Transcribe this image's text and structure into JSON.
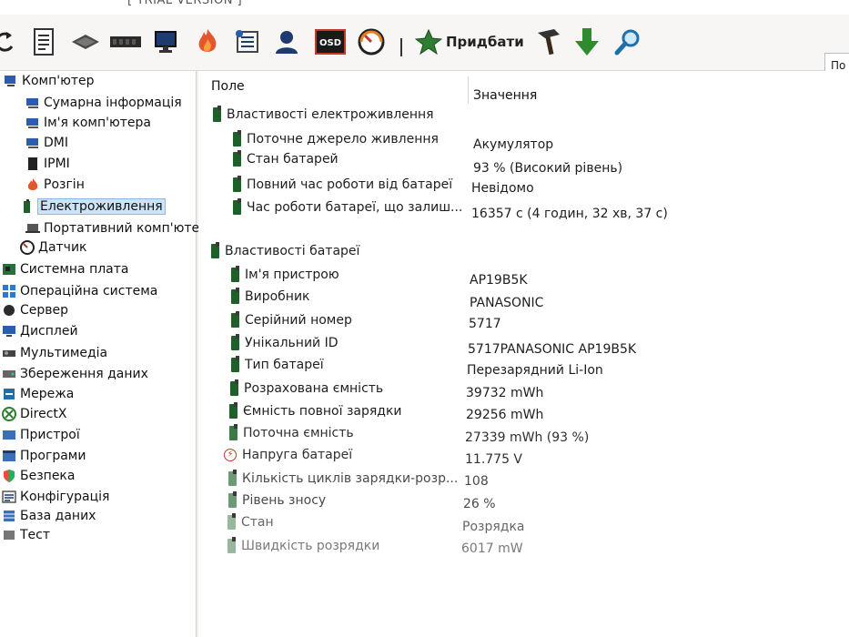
{
  "window": {
    "title_fragment": "[ TRIAL VERSION ]"
  },
  "toolbar": {
    "buy_label": "Придбати",
    "right_button_label": "По"
  },
  "sidebar": {
    "root_label": "Комп'ютер",
    "items": [
      {
        "label": "Сумарна інформація",
        "icon": "computer-icon"
      },
      {
        "label": "Ім'я комп'ютера",
        "icon": "computer-icon"
      },
      {
        "label": "DMI",
        "icon": "computer-icon"
      },
      {
        "label": "IPMI",
        "icon": "chip-icon"
      },
      {
        "label": "Розгін",
        "icon": "flame-icon"
      },
      {
        "label": "Електроживлення",
        "icon": "battery-icon",
        "selected": true
      },
      {
        "label": "Портативний комп'юте",
        "icon": "laptop-icon"
      },
      {
        "label": "Датчик",
        "icon": "gauge-icon"
      }
    ],
    "sections": [
      {
        "label": "Системна плата",
        "icon": "motherboard-icon"
      },
      {
        "label": "Операційна система",
        "icon": "windows-icon"
      },
      {
        "label": "Сервер",
        "icon": "server-icon"
      },
      {
        "label": "Дисплей",
        "icon": "display-icon"
      },
      {
        "label": "Мультимедіа",
        "icon": "multimedia-icon"
      },
      {
        "label": "Збереження даних",
        "icon": "storage-icon"
      },
      {
        "label": "Мережа",
        "icon": "network-icon"
      },
      {
        "label": "DirectX",
        "icon": "directx-icon"
      },
      {
        "label": "Пристрої",
        "icon": "devices-icon"
      },
      {
        "label": "Програми",
        "icon": "programs-icon"
      },
      {
        "label": "Безпека",
        "icon": "shield-icon"
      },
      {
        "label": "Конфігурація",
        "icon": "config-icon"
      },
      {
        "label": "База даних",
        "icon": "database-icon"
      },
      {
        "label": "Тест",
        "icon": "test-icon"
      }
    ]
  },
  "main": {
    "columns": {
      "field": "Поле",
      "value": "Значення"
    },
    "group1": {
      "title": "Властивості електроживлення",
      "rows": [
        {
          "field": "Поточне джерело живлення",
          "value": "Акумулятор"
        },
        {
          "field": "Стан батарей",
          "value": "93 % (Високий рівень)"
        },
        {
          "field": "Повний час роботи від батареї",
          "value": "Невідомо"
        },
        {
          "field": "Час роботи батареї, що залиш...",
          "value": "16357 с (4 годин, 32 хв, 37 с)"
        }
      ]
    },
    "group2": {
      "title": "Властивості батареї",
      "rows": [
        {
          "field": "Ім'я пристрою",
          "value": "AP19B5K"
        },
        {
          "field": "Виробник",
          "value": "PANASONIC"
        },
        {
          "field": "Серійний номер",
          "value": "5717"
        },
        {
          "field": "Унікальний ID",
          "value": "5717PANASONIC AP19B5K"
        },
        {
          "field": "Тип батареї",
          "value": "Перезарядний Li-Ion"
        },
        {
          "field": "Розрахована ємність",
          "value": "39732 mWh"
        },
        {
          "field": "Ємність повної зарядки",
          "value": "29256 mWh"
        },
        {
          "field": "Поточна ємність",
          "value": "27339 mWh  (93 %)"
        },
        {
          "field": "Напруга батареї",
          "value": "11.775 V"
        },
        {
          "field": "Кількість циклів зарядки-розр...",
          "value": "108"
        },
        {
          "field": "Рівень зносу",
          "value": "26 %"
        },
        {
          "field": "Стан",
          "value": "Розрядка"
        },
        {
          "field": "Швидкість розрядки",
          "value": "6017 mW"
        }
      ]
    }
  }
}
